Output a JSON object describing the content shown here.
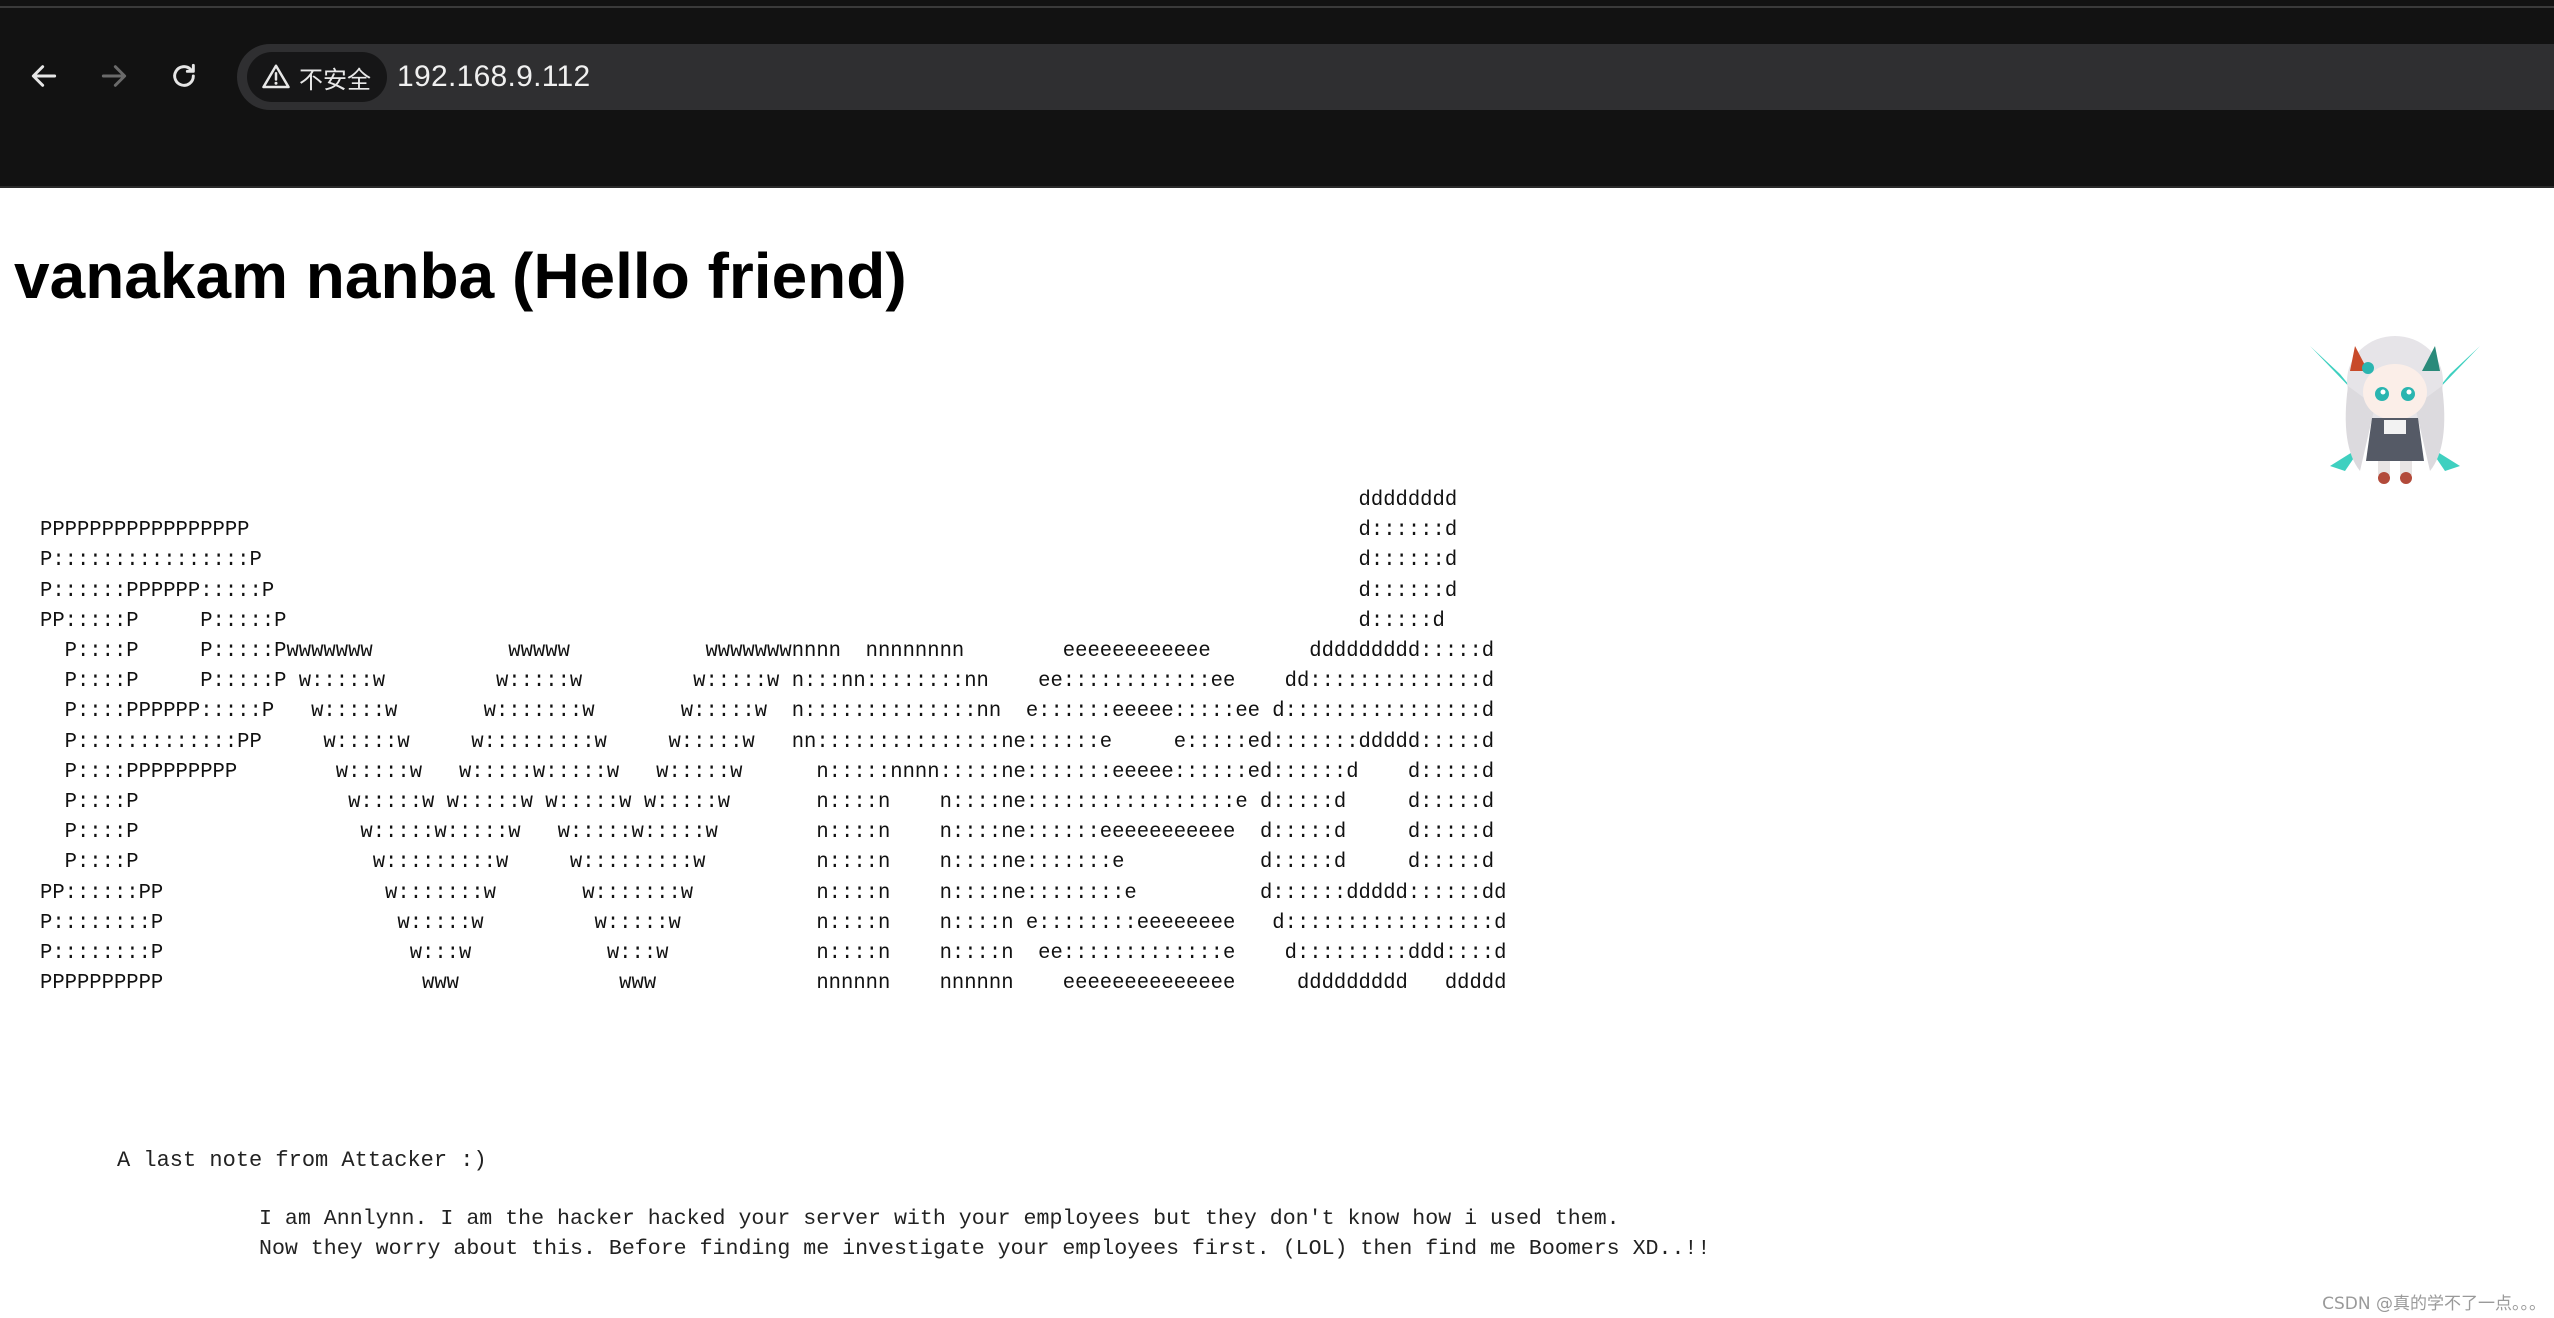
{
  "browser": {
    "security_label": "不安全",
    "url": "192.168.9.112",
    "icons": [
      "back-arrow-icon",
      "forward-arrow-icon",
      "reload-icon",
      "warning-triangle-icon"
    ]
  },
  "page": {
    "heading": "vanakam nanba (Hello friend)",
    "ascii_art": "                                                                                                           dddddddd\nPPPPPPPPPPPPPPPPP                                                                                          d::::::d\nP::::::::::::::::P                                                                                         d::::::d\nP::::::PPPPPP:::::P                                                                                        d::::::d\nPP:::::P     P:::::P                                                                                       d:::::d\n  P::::P     P:::::Pwwwwwww           wwwww           wwwwwwwnnnn  nnnnnnnn        eeeeeeeeeeee        ddddddddd:::::d\n  P::::P     P:::::P w:::::w         w:::::w         w:::::w n:::nn::::::::nn    ee::::::::::::ee    dd::::::::::::::d\n  P::::PPPPPP:::::P   w:::::w       w:::::::w       w:::::w  n::::::::::::::nn  e::::::eeeee:::::ee d::::::::::::::::d\n  P:::::::::::::PP     w:::::w     w:::::::::w     w:::::w   nn:::::::::::::::ne::::::e     e:::::ed:::::::ddddd:::::d\n  P::::PPPPPPPPP        w:::::w   w:::::w:::::w   w:::::w      n:::::nnnn:::::ne:::::::eeeee::::::ed::::::d    d:::::d\n  P::::P                 w:::::w w:::::w w:::::w w:::::w       n::::n    n::::ne:::::::::::::::::e d:::::d     d:::::d\n  P::::P                  w:::::w:::::w   w:::::w:::::w        n::::n    n::::ne::::::eeeeeeeeeee  d:::::d     d:::::d\n  P::::P                   w:::::::::w     w:::::::::w         n::::n    n::::ne:::::::e           d:::::d     d:::::d\nPP::::::PP                  w:::::::w       w:::::::w          n::::n    n::::ne::::::::e          d::::::ddddd::::::dd\nP::::::::P                   w:::::w         w:::::w           n::::n    n::::n e::::::::eeeeeeee   d:::::::::::::::::d\nP::::::::P                    w:::w           w:::w            n::::n    n::::n  ee:::::::::::::e    d:::::::::ddd::::d\nPPPPPPPPPP                     www             www             nnnnnn    nnnnnn    eeeeeeeeeeeeee     ddddddddd   ddddd",
    "note_title": "A last note from Attacker :)",
    "note_line_1": "I am Annlynn. I am the hacker hacked your server with your employees but they don't know how i used them.",
    "note_line_2": "Now they worry about this. Before finding me investigate your employees first. (LOL) then find me Boomers XD..!!",
    "mascot": "anime-chibi-mascot-image",
    "watermark": "CSDN @真的学不了一点。。。"
  }
}
